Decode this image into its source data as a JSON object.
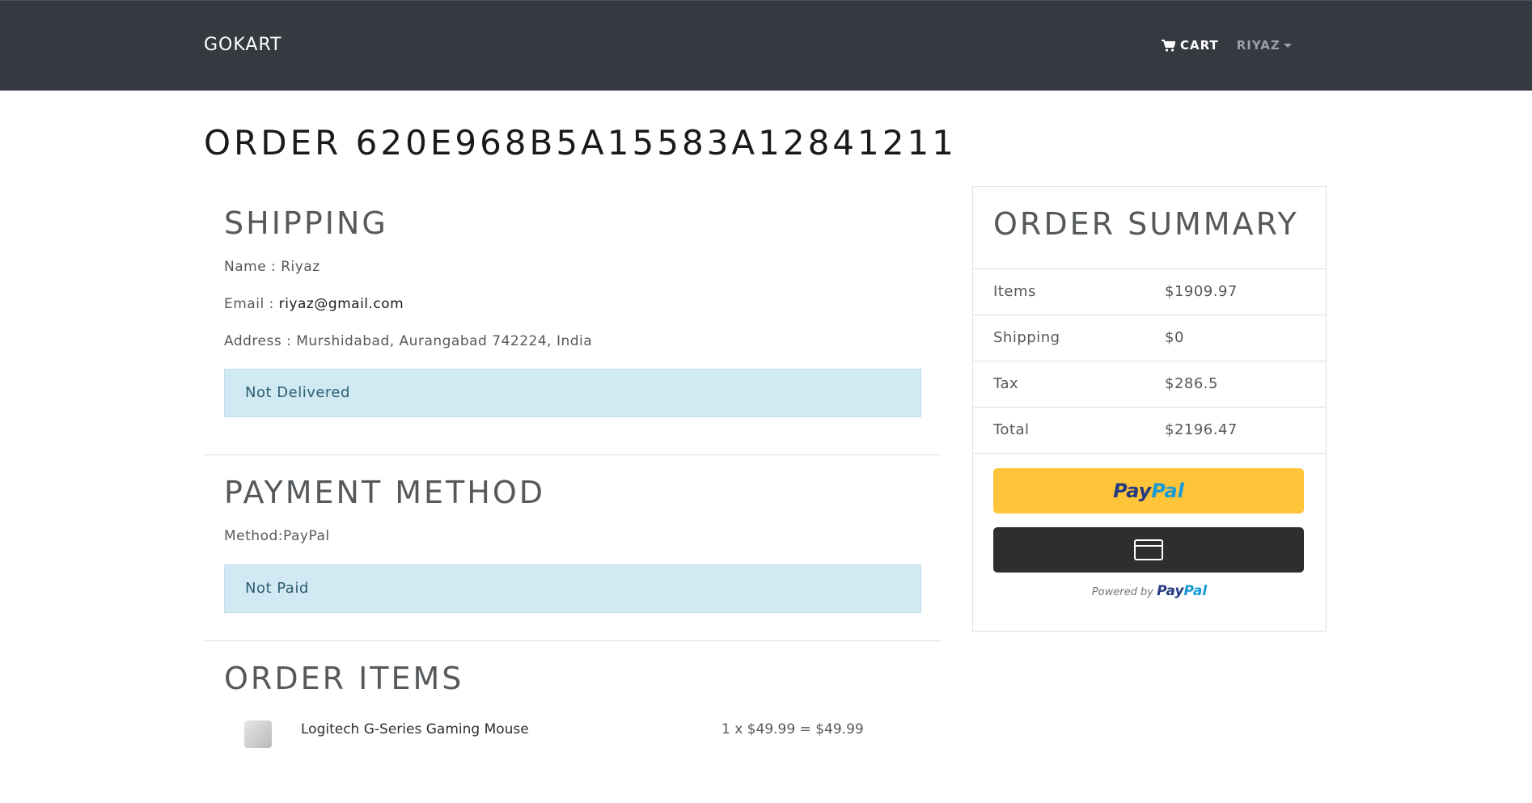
{
  "navbar": {
    "brand": "GOKART",
    "cart_label": "CART",
    "user_label": "RIYAZ"
  },
  "page": {
    "title": "ORDER 620E968B5A15583A12841211"
  },
  "shipping": {
    "heading": "SHIPPING",
    "name_label": "Name : ",
    "name": "Riyaz",
    "email_label": "Email : ",
    "email": "riyaz@gmail.com",
    "address_label": "Address : ",
    "address": "Murshidabad, Aurangabad 742224, India",
    "status": "Not Delivered"
  },
  "payment": {
    "heading": "PAYMENT METHOD",
    "method_label": "Method:",
    "method": "PayPal",
    "status": "Not Paid"
  },
  "order_items": {
    "heading": "ORDER ITEMS",
    "items": [
      {
        "name": "Logitech G-Series Gaming Mouse",
        "price_line": "1 x $49.99 = $49.99"
      }
    ]
  },
  "summary": {
    "heading": "ORDER SUMMARY",
    "rows": [
      {
        "label": "Items",
        "value": "$1909.97"
      },
      {
        "label": "Shipping",
        "value": "$0"
      },
      {
        "label": "Tax",
        "value": "$286.5"
      },
      {
        "label": "Total",
        "value": "$2196.47"
      }
    ],
    "paypal_logo_part1": "Pay",
    "paypal_logo_part2": "Pal",
    "powered_by": "Powered by "
  },
  "colors": {
    "navbar_bg": "#343a40",
    "alert_bg": "#d1e9f3",
    "paypal_gold": "#ffc439",
    "paypal_dark": "#2c2e2f"
  },
  "icons": [
    "shopping-cart-icon",
    "caret-down-icon",
    "credit-card-icon"
  ]
}
